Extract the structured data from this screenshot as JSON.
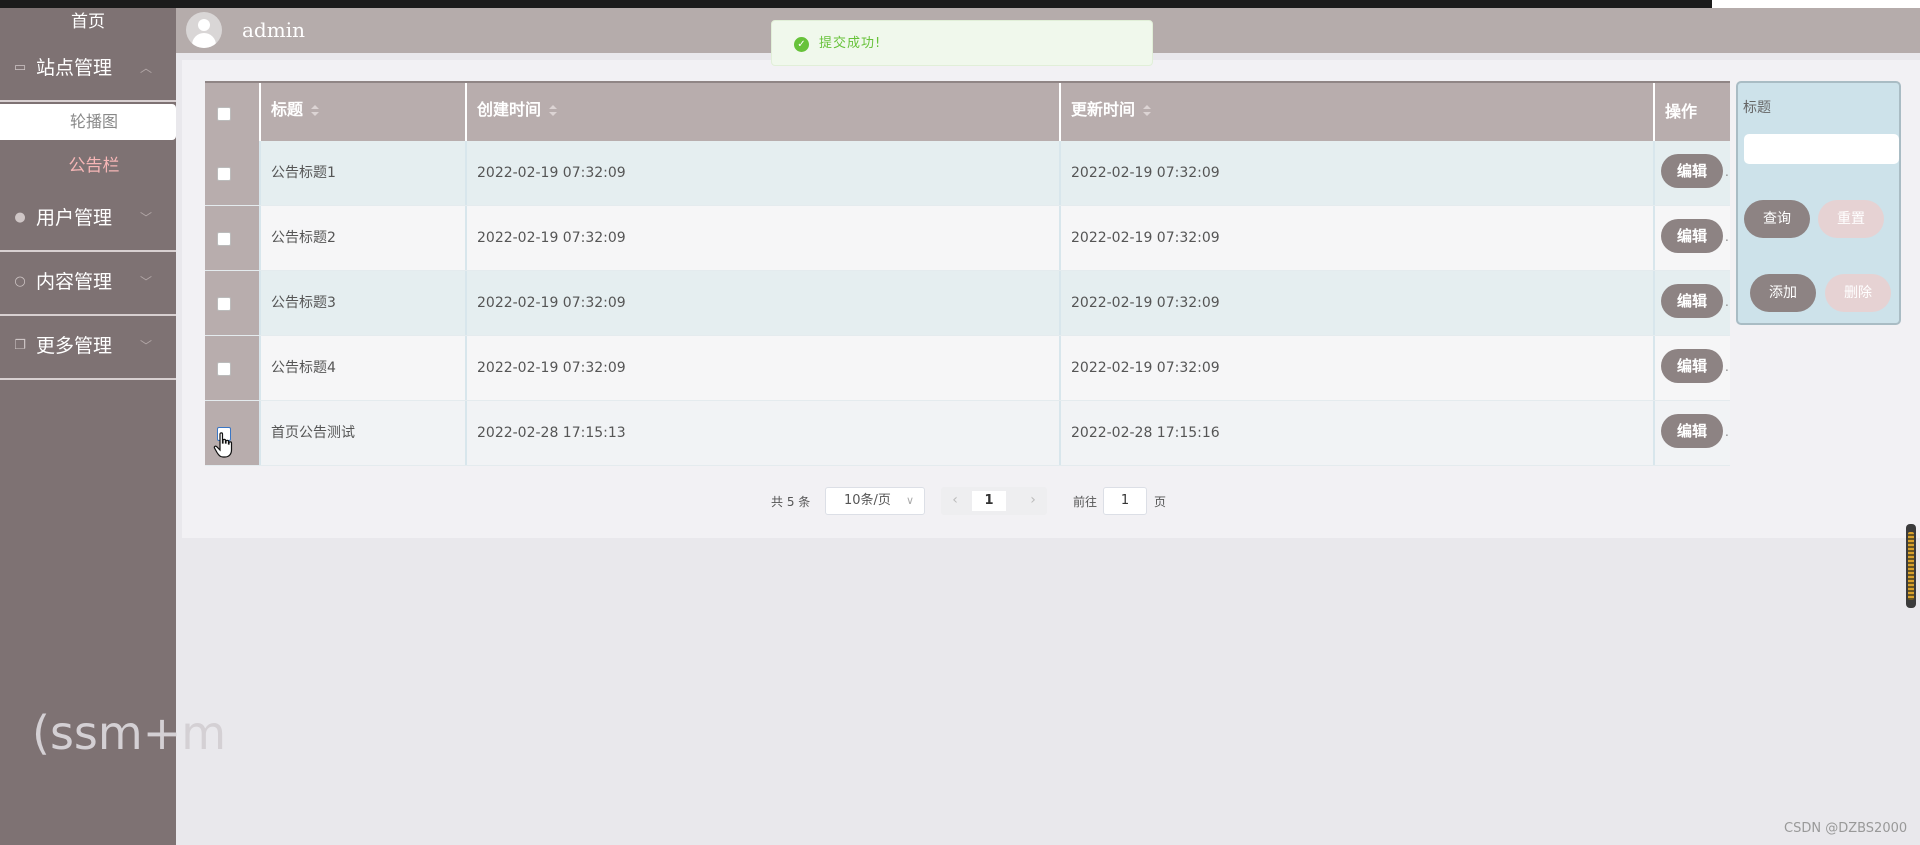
{
  "sidebar": {
    "home": "首页",
    "groups": [
      {
        "label": "站点管理",
        "icon": "monitor-icon",
        "expanded": true
      },
      {
        "label": "用户管理",
        "icon": "user-icon",
        "expanded": false
      },
      {
        "label": "内容管理",
        "icon": "chat-icon",
        "expanded": false
      },
      {
        "label": "更多管理",
        "icon": "copy-icon",
        "expanded": false
      }
    ],
    "sub_items": [
      {
        "label": "轮播图",
        "active": true
      },
      {
        "label": "公告栏",
        "active": false
      }
    ]
  },
  "header": {
    "username": "admin"
  },
  "toast": {
    "message": "提交成功!",
    "type": "success"
  },
  "table": {
    "columns": [
      "标题",
      "创建时间",
      "更新时间",
      "操作"
    ],
    "rows": [
      {
        "title": "公告标题1",
        "created": "2022-02-19 07:32:09",
        "updated": "2022-02-19 07:32:09"
      },
      {
        "title": "公告标题2",
        "created": "2022-02-19 07:32:09",
        "updated": "2022-02-19 07:32:09"
      },
      {
        "title": "公告标题3",
        "created": "2022-02-19 07:32:09",
        "updated": "2022-02-19 07:32:09"
      },
      {
        "title": "公告标题4",
        "created": "2022-02-19 07:32:09",
        "updated": "2022-02-19 07:32:09"
      },
      {
        "title": "首页公告测试",
        "created": "2022-02-28 17:15:13",
        "updated": "2022-02-28 17:15:16"
      }
    ],
    "edit_label": "编辑",
    "more_label": "."
  },
  "pagination": {
    "total": "共 5 条",
    "page_size": "10条/页",
    "current_page": "1",
    "goto_prefix": "前往",
    "goto_value": "1",
    "goto_suffix": "页"
  },
  "search": {
    "label": "标题",
    "value": "",
    "query": "查询",
    "reset": "重置",
    "add": "添加",
    "delete": "删除"
  },
  "watermark": "(ssm+m",
  "credit": "CSDN @DZBS2000",
  "colors": {
    "sidebar": "#7e7273",
    "header": "#b5acab",
    "button_dark": "#8d8383",
    "row_alt": "#e5eef0",
    "success": "#67c23a",
    "search_panel": "#cde2ea"
  }
}
